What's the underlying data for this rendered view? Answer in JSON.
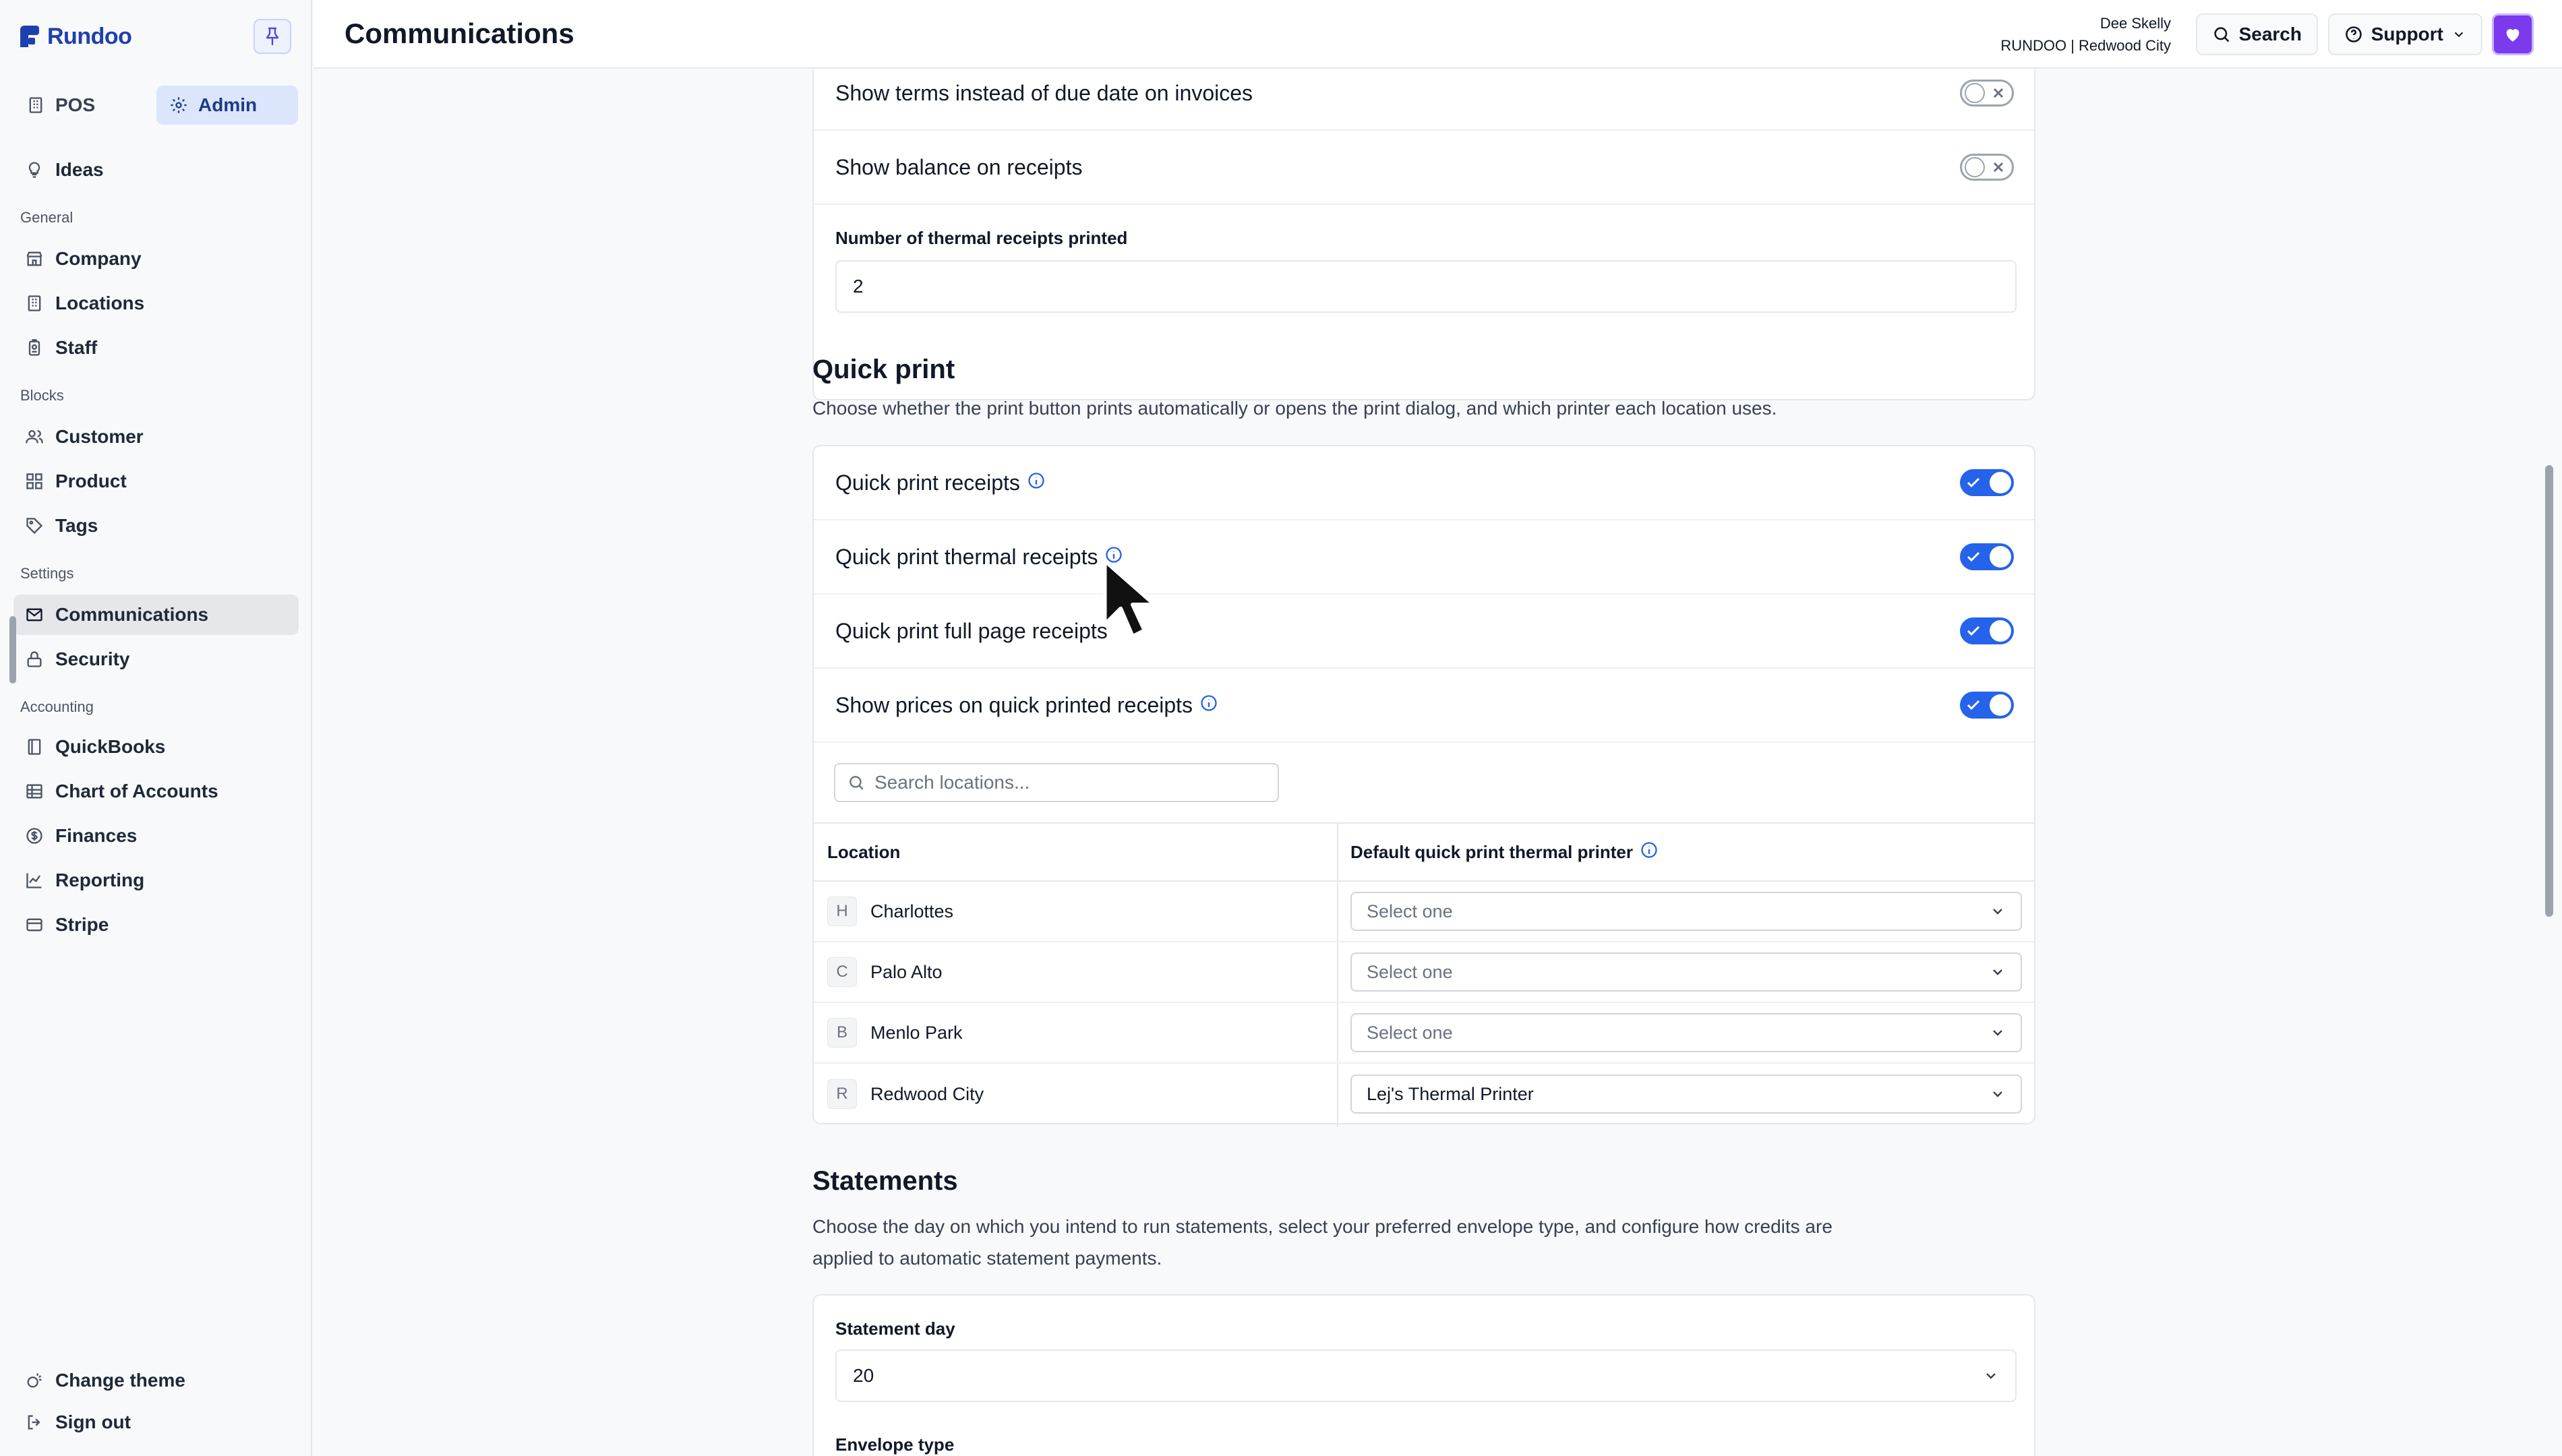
{
  "app": {
    "name": "Rundoo"
  },
  "header": {
    "title": "Communications",
    "user_name": "Dee Skelly",
    "user_org": "RUNDOO | Redwood City",
    "search_label": "Search",
    "support_label": "Support"
  },
  "sidebar": {
    "mode_pos": "POS",
    "mode_admin": "Admin",
    "ideas": "Ideas",
    "sections": {
      "general": "General",
      "blocks": "Blocks",
      "settings": "Settings",
      "accounting": "Accounting"
    },
    "items": {
      "company": "Company",
      "locations": "Locations",
      "staff": "Staff",
      "customer": "Customer",
      "product": "Product",
      "tags": "Tags",
      "communications": "Communications",
      "security": "Security",
      "quickbooks": "QuickBooks",
      "chart_of_accounts": "Chart of Accounts",
      "finances": "Finances",
      "reporting": "Reporting",
      "stripe": "Stripe"
    },
    "change_theme": "Change theme",
    "sign_out": "Sign out"
  },
  "receipts_card": {
    "show_terms": {
      "label": "Show terms instead of due date on invoices",
      "on": false
    },
    "show_balance": {
      "label": "Show balance on receipts",
      "on": false
    },
    "thermal_count_label": "Number of thermal receipts printed",
    "thermal_count_value": "2"
  },
  "quick_print": {
    "title": "Quick print",
    "description": "Choose whether the print button prints automatically or opens the print dialog, and which printer each location uses.",
    "toggles": [
      {
        "label": "Quick print receipts",
        "on": true
      },
      {
        "label": "Quick print thermal receipts",
        "on": true
      },
      {
        "label": "Quick print full page receipts",
        "on": true
      },
      {
        "label": "Show prices on quick printed receipts",
        "on": true
      }
    ],
    "search_placeholder": "Search locations...",
    "table": {
      "col_location": "Location",
      "col_printer": "Default quick print thermal printer",
      "rows": [
        {
          "initial": "H",
          "name": "Charlottes",
          "printer": "Select one"
        },
        {
          "initial": "C",
          "name": "Palo Alto",
          "printer": "Select one"
        },
        {
          "initial": "B",
          "name": "Menlo Park",
          "printer": "Select one"
        },
        {
          "initial": "R",
          "name": "Redwood City",
          "printer": "Lej's Thermal Printer"
        }
      ]
    }
  },
  "statements": {
    "title": "Statements",
    "description_line1": "Choose the day on which you intend to run statements, select your preferred envelope type, and configure how credits are",
    "description_line2": "applied to automatic statement payments.",
    "day_label": "Statement day",
    "day_value": "20",
    "envelope_label": "Envelope type"
  },
  "colors": {
    "accent": "#2563eb",
    "brand": "#1e40af",
    "avatar": "#7c3aed"
  }
}
